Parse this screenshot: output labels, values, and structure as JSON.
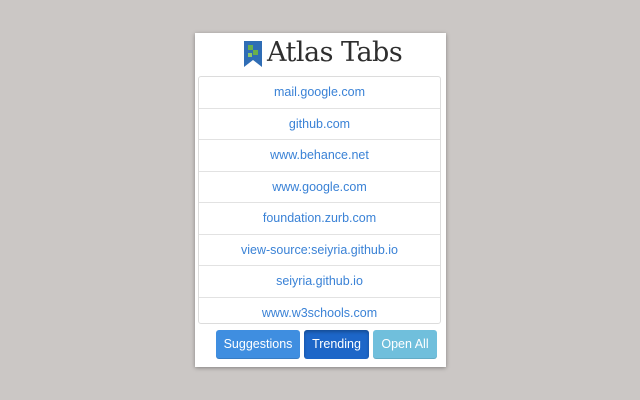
{
  "app": {
    "title": "Atlas Tabs"
  },
  "tabs": [
    {
      "url": "mail.google.com"
    },
    {
      "url": "github.com"
    },
    {
      "url": "www.behance.net"
    },
    {
      "url": "www.google.com"
    },
    {
      "url": "foundation.zurb.com"
    },
    {
      "url": "view-source:seiyria.github.io"
    },
    {
      "url": "seiyria.github.io"
    },
    {
      "url": "www.w3schools.com"
    }
  ],
  "buttons": {
    "suggestions": "Suggestions",
    "trending": "Trending",
    "open_all": "Open All"
  },
  "colors": {
    "background": "#cbc7c5",
    "link": "#3a82d6",
    "suggestions": "#3f8ee0",
    "trending_active": "#1d66c8",
    "open_all": "#70bfdc",
    "logo_blue": "#2f6db5",
    "logo_green": "#6ab04c"
  },
  "active_button": "trending"
}
